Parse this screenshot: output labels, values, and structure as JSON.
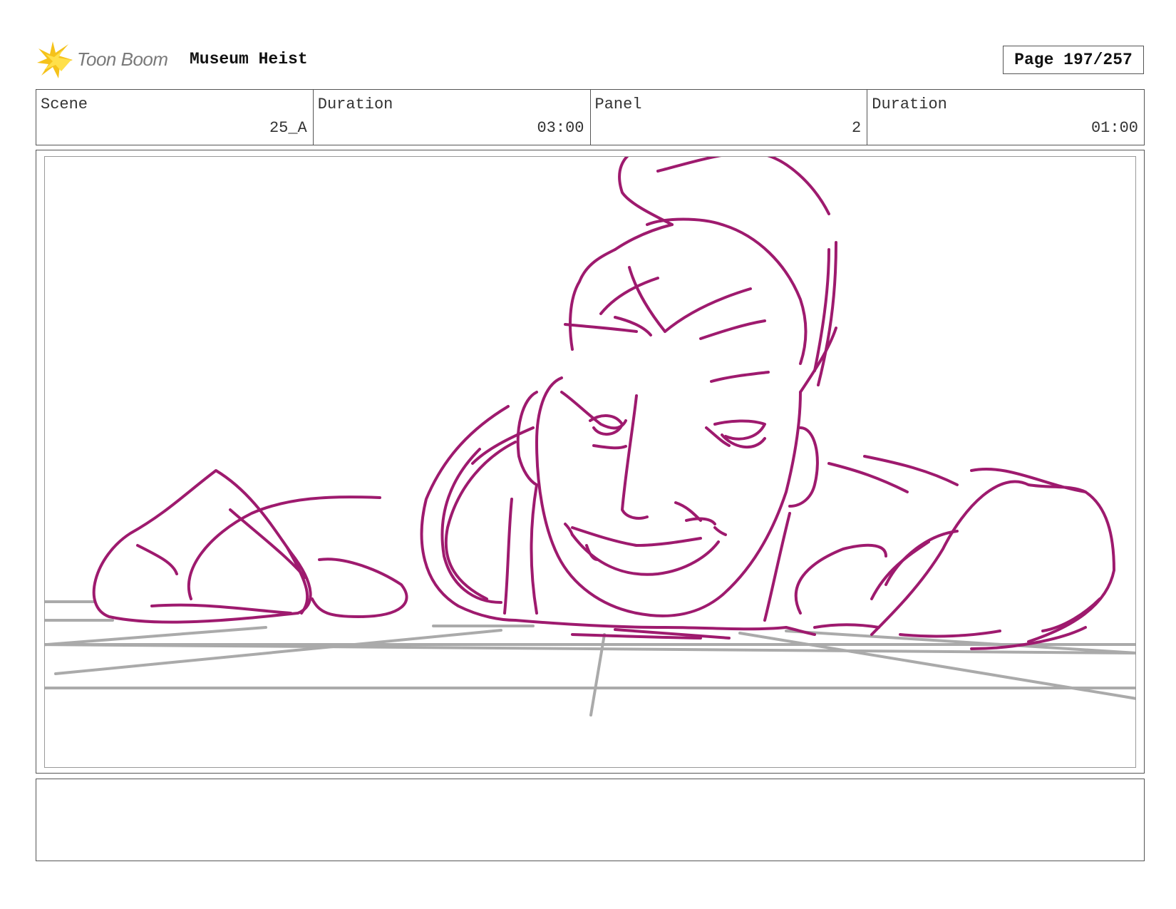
{
  "header": {
    "logo_text": "Toon Boom",
    "project_title": "Museum Heist",
    "page_label": "Page 197/257"
  },
  "info": {
    "scene_label": "Scene",
    "scene_value": "25_A",
    "scene_duration_label": "Duration",
    "scene_duration_value": "03:00",
    "panel_label": "Panel",
    "panel_value": "2",
    "panel_duration_label": "Duration",
    "panel_duration_value": "01:00"
  },
  "panel": {
    "sketch_color": "#9e1a6e",
    "guide_color": "#aaaaaa"
  },
  "notes": {
    "text": ""
  }
}
